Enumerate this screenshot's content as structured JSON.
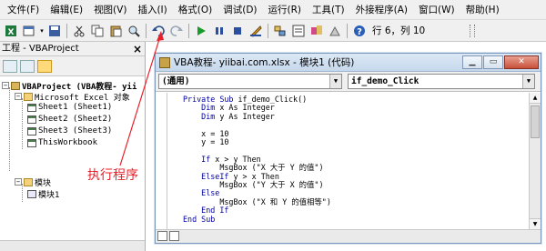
{
  "menubar": {
    "items": [
      "文件(F)",
      "编辑(E)",
      "视图(V)",
      "插入(I)",
      "格式(O)",
      "调试(D)",
      "运行(R)",
      "工具(T)",
      "外接程序(A)",
      "窗口(W)",
      "帮助(H)"
    ]
  },
  "toolbar": {
    "status": "行 6，列 10"
  },
  "project": {
    "title": "工程 - VBAProject",
    "close": "×",
    "tree": {
      "root": "VBAProject (VBA教程-  yii",
      "excel_folder": "Microsoft Excel 对象",
      "sheets": [
        "Sheet1 (Sheet1)",
        "Sheet2 (Sheet2)",
        "Sheet3 (Sheet3)",
        "ThisWorkbook"
      ],
      "modules_folder": "模块",
      "module1": "模块1"
    }
  },
  "codewin": {
    "title": "VBA教程-  yiibai.com.xlsx - 模块1 (代码)",
    "object_dropdown": "(通用)",
    "proc_dropdown": "if_demo_Click",
    "code_lines": [
      {
        "kw": "Private Sub ",
        "rest": "if_demo_Click()"
      },
      {
        "kw": "    Dim ",
        "rest": "x As Integer"
      },
      {
        "kw": "    Dim ",
        "rest": "y As Integer"
      },
      {
        "kw": "",
        "rest": ""
      },
      {
        "kw": "",
        "rest": "    x = 10"
      },
      {
        "kw": "",
        "rest": "    y = 10"
      },
      {
        "kw": "",
        "rest": ""
      },
      {
        "kw": "    If ",
        "rest": "x > y Then"
      },
      {
        "kw": "",
        "rest": "        MsgBox (\"X 大于 Y 的值\")"
      },
      {
        "kw": "    ElseIf ",
        "rest": "y > x Then"
      },
      {
        "kw": "",
        "rest": "        MsgBox (\"Y 大于 X 的值\")"
      },
      {
        "kw": "    Else",
        "rest": ""
      },
      {
        "kw": "",
        "rest": "        MsgBox (\"X 和 Y 的值相等\")"
      },
      {
        "kw": "    End If",
        "rest": ""
      },
      {
        "kw": "End Sub",
        "rest": ""
      }
    ]
  },
  "annotation": {
    "text": "执行程序",
    "color": "#e8202a"
  },
  "icons": {
    "toolbar": [
      "excel-icon",
      "insert-userform-icon",
      "save-icon",
      "cut-icon",
      "copy-icon",
      "paste-icon",
      "find-icon",
      "undo-icon",
      "redo-icon",
      "run-icon",
      "break-icon",
      "reset-icon",
      "design-mode-icon",
      "project-explorer-icon",
      "properties-icon",
      "object-browser-icon",
      "toolbox-icon",
      "help-icon"
    ]
  }
}
